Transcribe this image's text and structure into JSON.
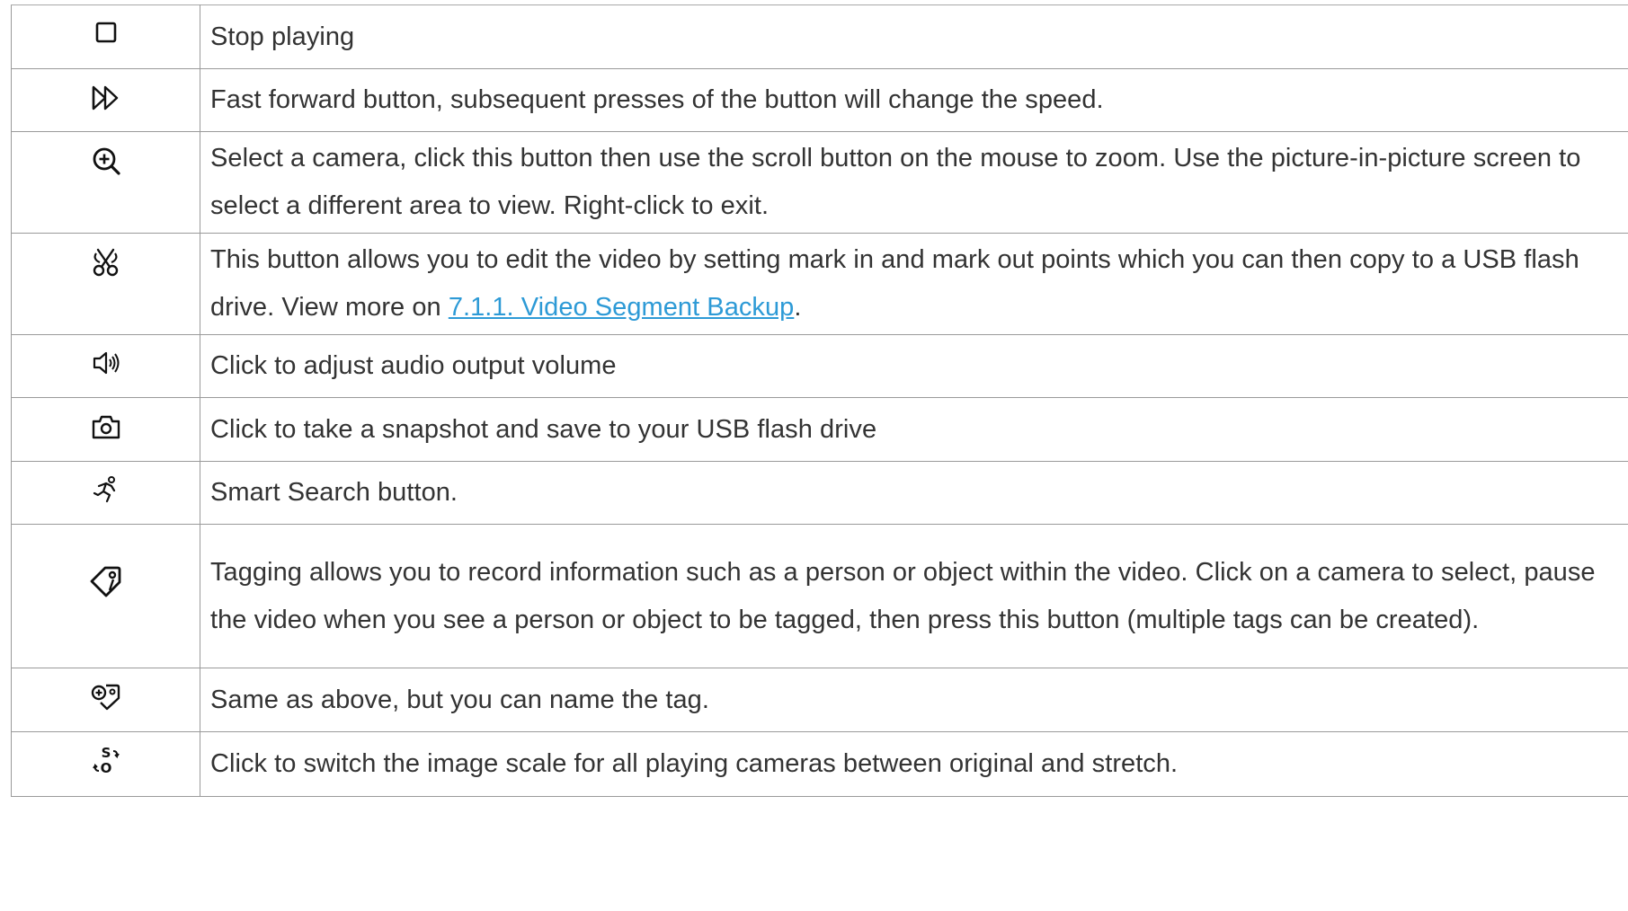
{
  "rows": [
    {
      "icon": "stop-icon",
      "text": "Stop playing"
    },
    {
      "icon": "fast-forward-icon",
      "text": "Fast forward button, subsequent presses of the button will change the speed."
    },
    {
      "icon": "zoom-in-icon",
      "text": "Select a camera, click this button then use the scroll button on the mouse to zoom. Use the picture-in-picture screen to select a different area to view. Right-click to exit."
    },
    {
      "icon": "scissors-icon",
      "text_before": "This button allows you to edit the video by setting mark in and mark out points which you can then copy to a USB flash drive. View more on ",
      "link": "7.1.1. Video Segment Backup",
      "text_after": "."
    },
    {
      "icon": "speaker-icon",
      "text": "Click to adjust audio output volume"
    },
    {
      "icon": "camera-icon",
      "text": "Click to take a snapshot and save to your USB flash drive"
    },
    {
      "icon": "running-person-icon",
      "text": "Smart Search button."
    },
    {
      "icon": "tag-icon",
      "text": "Tagging allows you to record information such as a person or object within the video. Click on a camera to select, pause the video when you see a person or object to be tagged, then press this button (multiple tags can be created)."
    },
    {
      "icon": "add-tag-icon",
      "text": "Same as above, but you can name the tag."
    },
    {
      "icon": "scale-switch-icon",
      "text": "Click to switch the image scale for all playing cameras between original and stretch."
    }
  ],
  "colors": {
    "text": "#333333",
    "link": "#2d9ad6",
    "border": "#9a9a9a"
  }
}
